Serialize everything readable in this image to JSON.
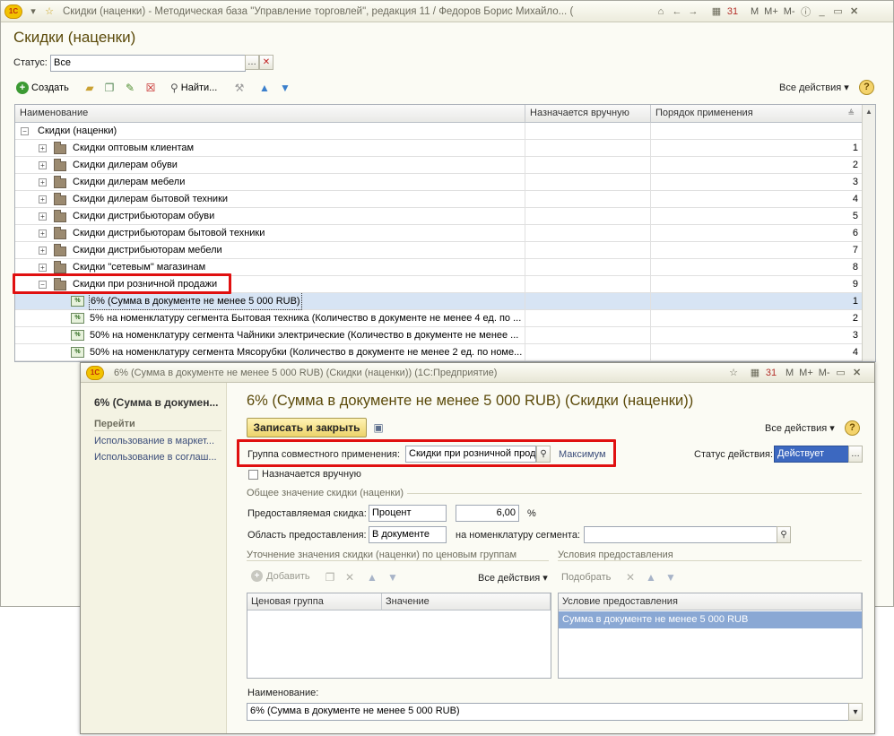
{
  "main": {
    "title": "Скидки (наценки) - Методическая база \"Управление торговлей\", редакция 11 / Федоров Борис Михайло... (1С:Предприятие)",
    "logo_text": "1С",
    "sys_buttons": [
      "M",
      "M+",
      "M-"
    ],
    "heading": "Скидки (наценки)",
    "status_label": "Статус:",
    "status_value": "Все",
    "toolbar": {
      "create": "Создать",
      "find": "Найти...",
      "all_actions": "Все действия ▾"
    },
    "columns": [
      "Наименование",
      "Назначается вручную",
      "Порядок применения"
    ],
    "root": "Скидки (наценки)",
    "groups": [
      {
        "name": "Скидки оптовым клиентам",
        "order": "1"
      },
      {
        "name": "Скидки дилерам обуви",
        "order": "2"
      },
      {
        "name": "Скидки дилерам мебели",
        "order": "3"
      },
      {
        "name": "Скидки дилерам бытовой техники",
        "order": "4"
      },
      {
        "name": "Скидки дистрибьюторам обуви",
        "order": "5"
      },
      {
        "name": "Скидки дистрибьюторам бытовой техники",
        "order": "6"
      },
      {
        "name": "Скидки дистрибьюторам мебели",
        "order": "7"
      },
      {
        "name": "Скидки \"сетевым\" магазинам",
        "order": "8"
      },
      {
        "name": "Скидки при розничной продажи",
        "order": "9"
      }
    ],
    "items": [
      {
        "name": "6% (Сумма в документе не менее 5 000 RUB)",
        "order": "1"
      },
      {
        "name": "5% на номенклатуру сегмента Бытовая техника (Количество в документе не менее 4 ед. по ...",
        "order": "2"
      },
      {
        "name": "50% на номенклатуру сегмента Чайники электрические (Количество в документе не менее ...",
        "order": "3"
      },
      {
        "name": "50% на номенклатуру сегмента Мясорубки (Количество в документе не менее 2 ед. по номе...",
        "order": "4"
      }
    ]
  },
  "dialog": {
    "title": "6% (Сумма в документе не менее 5 000 RUB) (Скидки (наценки))  (1С:Предприятие)",
    "heading": "6% (Сумма в документе не менее 5 000 RUB) (Скидки (наценки))",
    "nav": {
      "current": "6% (Сумма в докумен...",
      "goto_label": "Перейти",
      "links": [
        "Использование в маркет...",
        "Использование в соглаш..."
      ]
    },
    "save_close": "Записать и закрыть",
    "all_actions": "Все действия ▾",
    "joint_group_label": "Группа совместного применения:",
    "joint_group_value": "Скидки при розничной прод",
    "joint_group_mode": "Максимум",
    "status_label": "Статус действия:",
    "status_value": "Действует",
    "manual_label": "Назначается вручную",
    "general_group": "Общее значение скидки (наценки)",
    "discount_label": "Предоставляемая скидка:",
    "discount_type": "Процент",
    "discount_value": "6,00",
    "discount_unit": "%",
    "area_label": "Область предоставления:",
    "area_value": "В документе",
    "segment_label": "на номенклатуру сегмента:",
    "segment_value": "",
    "price_group_title": "Уточнение значения скидки (наценки) по ценовым группам",
    "add_label": "Добавить",
    "sub_all_actions": "Все действия ▾",
    "price_cols": [
      "Ценовая группа",
      "Значение"
    ],
    "cond_title": "Условия предоставления",
    "pick_label": "Подобрать",
    "cond_col": "Условие предоставления",
    "cond_rows": [
      "Сумма в документе не менее 5 000 RUB"
    ],
    "name_label": "Наименование:",
    "name_value": "6% (Сумма в документе не менее 5 000 RUB)"
  }
}
